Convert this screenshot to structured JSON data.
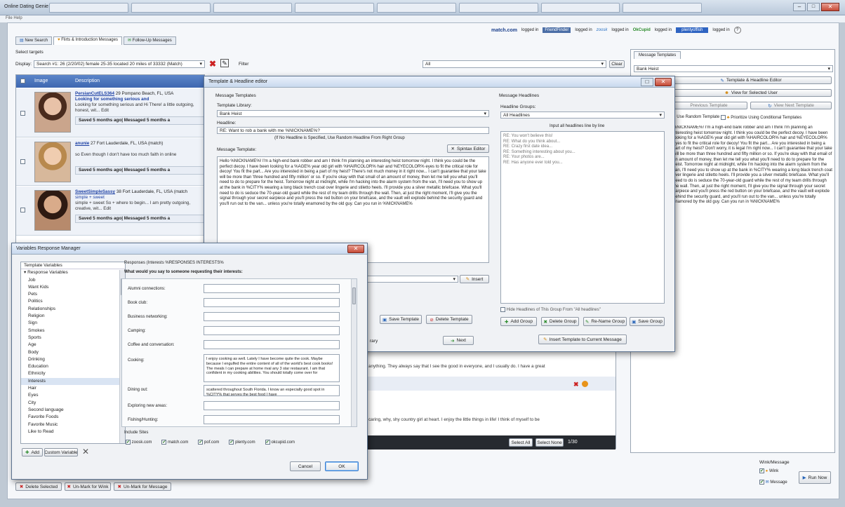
{
  "app": {
    "title": "Online Dating Genie",
    "menu": "File  Help",
    "browser_tabs": [
      "",
      "",
      "",
      "",
      "",
      "",
      "",
      "",
      "",
      ""
    ]
  },
  "sites": [
    {
      "name": "match.com",
      "status": "logged in"
    },
    {
      "name": "FriendFinder",
      "status": "logged in"
    },
    {
      "name": "zoosk",
      "status": "logged in"
    },
    {
      "name": "OkCupid",
      "status": "logged in"
    },
    {
      "name": "plentyoffish",
      "status": "logged in"
    }
  ],
  "main_tabs": [
    "New Search",
    "Flirts & Introduction Messages",
    "Follow-Up Messages"
  ],
  "targets": {
    "label": "Select targets",
    "display_label": "Display:",
    "display_value": "Search #1: 26 (2/20/02) female 25-35 located 20 miles of 33332 (Match)",
    "filter_label": "Filter",
    "filter_value": "All",
    "clear_btn": "Clear"
  },
  "table": {
    "headers": [
      "Image",
      "Description"
    ],
    "rows": [
      {
        "name": "PersianCutELS364",
        "meta": "29 Pompano Beach, FL, USA",
        "headline": "Looking for something serious and",
        "snippet": "Looking for something serious and Hi There! a little outgoing, honest, wit... Edit",
        "saved": "Saved 5 months ago| Messaged 5 months a"
      },
      {
        "name": "anunie",
        "meta": "27 Fort Lauderdale, FL, USA (match)",
        "headline": "",
        "snippet": "so Even though I don't have too much faith in online",
        "saved": "Saved 5 months ago| Messaged 5 months a"
      },
      {
        "name": "SweetSimpleSassy",
        "meta": "38 Fort Lauderdale, FL, USA (match",
        "headline": "simple + sweet",
        "snippet": "simple + sweet So + where to begin... I am pretty outgoing, creative, wit... Edit",
        "saved": "Saved 5 months ago| Messaged 5 months a"
      }
    ]
  },
  "message_body_1": "anything. They always say that I see the good in everyone, and I usually do. I have a great",
  "message_body_2": "caring, why, shy country girl at heart. I enjoy the little things in life! I think of myself to be",
  "select_all": "Select All",
  "select_none": "Select None",
  "page_count": "1/30",
  "bottom_buttons": [
    "Delete Selected",
    "Un-Mark for Wink",
    "Un-Mark for Message"
  ],
  "right_panel": {
    "tab": "Message Templates",
    "template_value": "Bank Heist",
    "editor_btn": "Template & Headline Editor",
    "view_selected_btn": "View for Selected User",
    "prev_btn": "Previous Template",
    "next_btn": "View Next Template",
    "random_label": "Use Random Template",
    "prioritize_label": "Prioritize Using Conditional Templates",
    "preview_text": "%NICKNAME%! I'm a high-end bank robber and am I think I'm planning an interesting heist tomorrow night. I think you could be the perfect decoy. I have been looking for a %AGE% year old girl with %HAIRCOLOR% hair and %EYECOLOR% eyes to fit the critical role for decoy! You fit the part... Are you interested in being a part of my heist? Don't worry, it is legal I'm right now... I can't guarantee that your take will be more than three hundred and fifty million or so. If you're okay with that email of an amount of money, then let me tell you what you'll need to do to prepare for the heist. Tomorrow night at midnight, while I'm hacking into the alarm system from the van, I'll need you to show up at the bank in %CITY% wearing a long black trench coat over lingerie and stiletto heels. I'll provide you a silver metallic briefcase. What you'll need to do is seduce the 70-year-old guard while the rest of my team drills through the wall. Then, at just the right moment, I'll give you the signal through your secret earpiece and you'll press the red button on your briefcase, and the vault will explode behind the security guard, and you'll run out to the van... unless you're totally enamored by the old guy. Can you run in %NICKNAME%"
  },
  "run_panel": {
    "title": "Wink/Message",
    "wink": "Wink",
    "message": "Message",
    "run": "Run Now"
  },
  "template_editor": {
    "title": "Template & Headline editor",
    "section_templates": "Message Templates",
    "library_label": "Template Library:",
    "library_value": "Bank Heist",
    "headline_label": "Headline:",
    "headline_value": "RE: Want to rob a bank with me %NICKNAME%?",
    "headline_hint": "(If No Headline is Specified, Use Random Headline From Right Group",
    "message_template_label": "Message Template:",
    "spintax_btn": "Spintax Editor",
    "template_text": "Hello %NICKNAME%! I'm a high-end bank robber and am I think I'm planning an interesting heist tomorrow night. I think you could be the perfect decoy. I have been looking for a %AGE% year old girl with %HAIRCOLOR% hair and %EYECOLOR% eyes to fit the critical role for decoy! You fit the part... Are you interested in being a part of my heist? There's not much money in it right now... I can't guarantee that your take will be more than 'three hundred and fifty million' or so. If you're okay with that small of an amount of money, then let me tell you what you'll need to do to prepare for the heist. Tomorrow night at midnight, while I'm hacking into the alarm system from the van, I'll need you to show up at the bank in %CITY% wearing a long black trench coat over lingerie and stiletto heels. I'll provide you a silver metallic briefcase. What you'll need to do is seduce the 70-year-old guard while the rest of my team drills through the wall. Then, at just the right moment, I'll give you the signal through your secret earpiece and you'll press the red button on your briefcase, and the vault will explode behind the security guard and you'll run out to the van... unless you're totally enamored by the old guy. Can you run in %NICKNAME%",
    "insert_btn": "Insert",
    "save_btn": "Save Template",
    "delete_btn": "Delete Template",
    "next_btn": "Next",
    "library_word": "rary",
    "section_headlines": "Message Headlines",
    "headline_groups_label": "Headline Groups:",
    "headline_groups_value": "All Headlines",
    "input_hint": "Input all headlines line by line",
    "headlines": [
      "RE: You won't believe this!",
      "RE: What do you think about...",
      "RE: Crazy first date idea...",
      "RE: Something interesting about you...",
      "RE: Your photos are...",
      "RE: Has anyone ever told you..."
    ],
    "hide_label": "Hide Headlines of This Group From \"All headlines\"",
    "add_group": "Add Group",
    "delete_group": "Delete Group",
    "rename_group": "Re-Name Group",
    "save_group": "Save Group",
    "insert_template_btn": "Insert Template to Current Message"
  },
  "variables": {
    "title": "Variables Response Manager",
    "tree_header": "Template Variables",
    "tree_root": "Response Variables",
    "items": [
      "Job",
      "Want Kids",
      "Pets",
      "Politics",
      "Relationships",
      "Religion",
      "Sign",
      "Smokes",
      "Sports",
      "Age",
      "Body",
      "Drinking",
      "Education",
      "Ethnicity",
      "Interests",
      "Hair",
      "Eyes",
      "City",
      "Second language",
      "Favorite Foods",
      "Favorite Music",
      "Like to Read"
    ],
    "selected": "Interests",
    "responses_label": "Responses (Interests %RESPONSES INTERESTS%",
    "question": "What would you say to someone requesting their interests:",
    "fields": [
      {
        "label": "Alumni connections:",
        "value": ""
      },
      {
        "label": "Book club:",
        "value": ""
      },
      {
        "label": "Business networking:",
        "value": ""
      },
      {
        "label": "Camping:",
        "value": ""
      },
      {
        "label": "Coffee and conversation:",
        "value": ""
      },
      {
        "label": "Cooking:",
        "value": "I enjoy cooking as well. Lately I have become quite the cook. Maybe because I engulfed the entire content of all of the world's best cook books! The meals I can prepare at home rival any 3 star restaurant. I am that confident in my cooking abilities. You should totally come over for"
      },
      {
        "label": "Dining out:",
        "value": "scattered throughout South Florida. I know an especially good spot in %CITY% that serves the best food I have"
      },
      {
        "label": "Exploring new areas:",
        "value": ""
      },
      {
        "label": "Fishing/Hunting:",
        "value": ""
      }
    ],
    "include_label": "Include Sites",
    "sites": [
      "zoosk.com",
      "match.com",
      "pof.com",
      "plenty.com",
      "okcupid.com"
    ],
    "add_btn": "Add",
    "custom_btn": "Custom Variable",
    "cancel_btn": "Cancel",
    "ok_btn": "OK"
  }
}
